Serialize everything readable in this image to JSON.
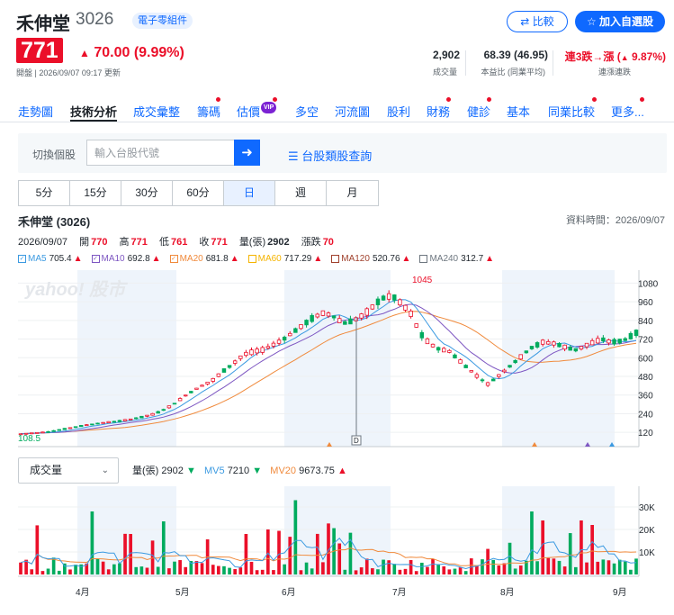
{
  "header": {
    "name": "禾伸堂",
    "code": "3026",
    "sector": "電子零組件",
    "compare_label": "比較",
    "watchlist_label": "加入自選股",
    "price": "771",
    "change": "70.00 (9.99%)",
    "open_time": "開盤 | 2026/09/07 09:17 更新",
    "volume_value": "2,902",
    "volume_label": "成交量",
    "pe_value": "68.39 (46.95)",
    "pe_label": "本益比 (同業平均)",
    "streak_value_a": "連3跌→漲 (",
    "streak_value_b": "9.87%)",
    "streak_label": "連漲連跌"
  },
  "tabs": [
    "走勢圖",
    "技術分析",
    "成交彙整",
    "籌碼",
    "估價",
    "多空",
    "河流圖",
    "股利",
    "財務",
    "健診",
    "基本",
    "同業比較",
    "更多..."
  ],
  "vip_label": "VIP",
  "search": {
    "label": "切換個股",
    "placeholder": "輸入台股代號",
    "category_link": "台股類股查詢"
  },
  "periods": [
    "5分",
    "15分",
    "30分",
    "60分",
    "日",
    "週",
    "月"
  ],
  "chart_header": {
    "title": "禾伸堂 (3026)",
    "data_time": "資料時間：2026/09/07",
    "date": "2026/09/07",
    "open_label": "開",
    "open": "770",
    "high_label": "高",
    "high": "771",
    "low_label": "低",
    "low": "761",
    "close_label": "收",
    "close": "771",
    "vol_label": "量(張)",
    "vol": "2902",
    "chg_label": "漲跌",
    "chg": "70"
  },
  "ma_legend": [
    {
      "name": "MA5",
      "value": "705.4",
      "color": "#3b9ae1",
      "checked": true
    },
    {
      "name": "MA10",
      "value": "692.8",
      "color": "#7e57c2",
      "checked": true
    },
    {
      "name": "MA20",
      "value": "681.8",
      "color": "#f08a3c",
      "checked": true
    },
    {
      "name": "MA60",
      "value": "717.29",
      "color": "#f5b400",
      "checked": false
    },
    {
      "name": "MA120",
      "value": "520.76",
      "color": "#a0412d",
      "checked": false
    },
    {
      "name": "MA240",
      "value": "312.7",
      "color": "#6e7780",
      "checked": false
    }
  ],
  "watermark": "yahoo! 股市",
  "volume_panel": {
    "selector": "成交量",
    "vol_label": "量(張)",
    "vol_value": "2902",
    "mv5_label": "MV5",
    "mv5_value": "7210",
    "mv20_label": "MV20",
    "mv20_value": "9673.75"
  },
  "chart_data": {
    "type": "candlestick",
    "price_ylim": [
      40,
      1140
    ],
    "price_ticks": [
      120,
      240,
      360,
      480,
      600,
      720,
      840,
      960,
      1080
    ],
    "volume_ylim": [
      0,
      36000
    ],
    "volume_ticks": [
      "10K",
      "20K",
      "30K"
    ],
    "volume_tick_values": [
      10000,
      20000,
      30000
    ],
    "x_labels": [
      "4月",
      "5月",
      "6月",
      "7月",
      "8月",
      "9月"
    ],
    "min_label": "108.5",
    "max_label": "1045",
    "dividend_marker": "D",
    "colors": {
      "up": "#eb0f29",
      "down": "#00ab5e",
      "ma5": "#3b9ae1",
      "ma10": "#7e57c2",
      "ma20": "#f08a3c"
    }
  }
}
